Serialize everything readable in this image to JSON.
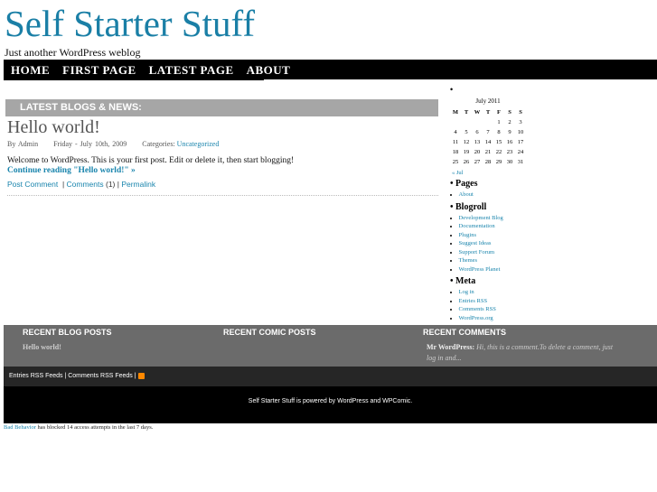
{
  "site": {
    "title": "Self Starter Stuff",
    "tagline": "Just another WordPress weblog"
  },
  "nav": [
    "HOME",
    "FIRST PAGE",
    "LATEST PAGE",
    "ABOUT"
  ],
  "latest_heading": "LATEST BLOGS & NEWS:",
  "post": {
    "title": "Hello world!",
    "author": "By Admin",
    "date": "Friday - July 10th, 2009",
    "categories_label": "Categories:",
    "category": "Uncategorized",
    "excerpt": "Welcome to WordPress. This is your first post. Edit or delete it, then start blogging!",
    "more": "Continue reading \"Hello world!\" »",
    "post_comment": "Post Comment",
    "comments": "Comments",
    "comment_count": "(1)",
    "permalink": "Permalink"
  },
  "calendar": {
    "caption": "July 2011",
    "days": [
      "M",
      "T",
      "W",
      "T",
      "F",
      "S",
      "S"
    ],
    "weeks": [
      [
        "",
        "",
        "",
        "",
        "1",
        "2",
        "3"
      ],
      [
        "4",
        "5",
        "6",
        "7",
        "8",
        "9",
        "10"
      ],
      [
        "11",
        "12",
        "13",
        "14",
        "15",
        "16",
        "17"
      ],
      [
        "18",
        "19",
        "20",
        "21",
        "22",
        "23",
        "24"
      ],
      [
        "25",
        "26",
        "27",
        "28",
        "29",
        "30",
        "31"
      ]
    ],
    "prev": "« Jul"
  },
  "sidebar": {
    "pages_title": "Pages",
    "pages": [
      "About"
    ],
    "blogroll_title": "Blogroll",
    "blogroll": [
      "Development Blog",
      "Documentation",
      "Plugins",
      "Suggest Ideas",
      "Support Forum",
      "Themes",
      "WordPress Planet"
    ],
    "meta_title": "Meta",
    "meta": [
      "Log in",
      "Entries RSS",
      "Comments RSS",
      "WordPress.org"
    ]
  },
  "footer": {
    "recent_blog_title": "RECENT BLOG POSTS",
    "recent_blog": "Hello world!",
    "recent_comic_title": "RECENT COMIC POSTS",
    "recent_comments_title": "RECENT COMMENTS",
    "comment_author": "Mr WordPress:",
    "comment_text": "Hi, this is a comment.To delete a comment, just log in and...",
    "feeds": "Entries RSS Feeds | Comments RSS Feeds |",
    "powered": "Self Starter Stuff is powered by WordPress and WPComic.",
    "bb_link": "Bad Behavior",
    "bb_text": " has blocked 14 access attempts in the last 7 days."
  }
}
